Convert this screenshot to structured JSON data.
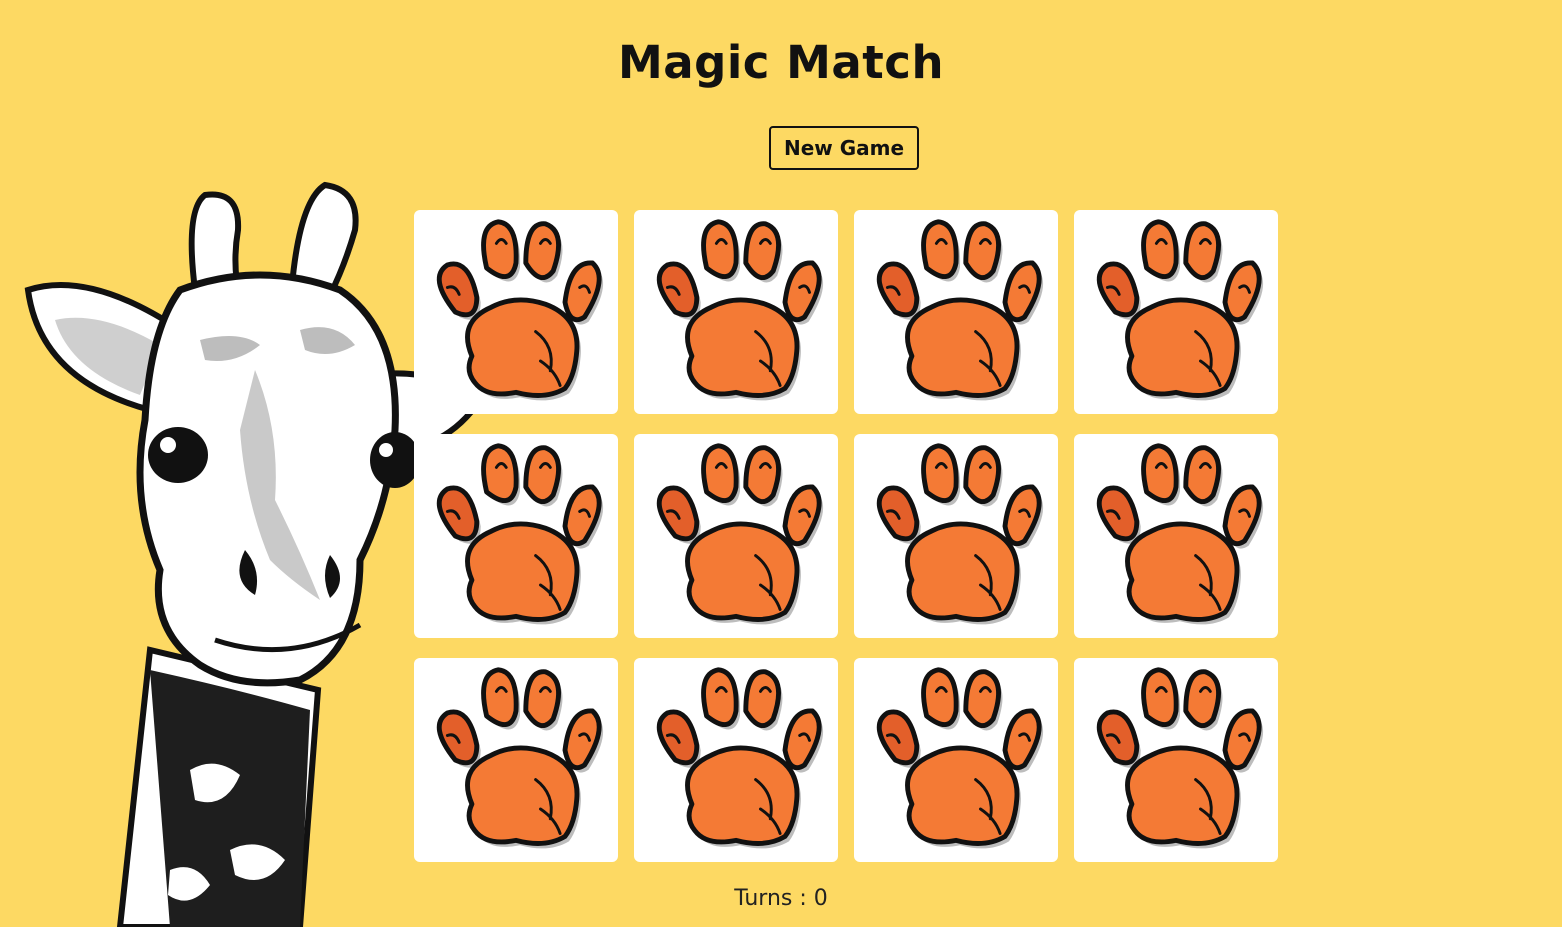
{
  "game": {
    "title": "Magic Match",
    "new_game_label": "New Game",
    "turns_label": "Turns : 0",
    "card_back_icon": "paw-print-icon",
    "card_count": 12,
    "colors": {
      "background": "#fdd963",
      "card": "#ffffff",
      "paw": "#f47a35",
      "paw_outline": "#111111"
    }
  }
}
